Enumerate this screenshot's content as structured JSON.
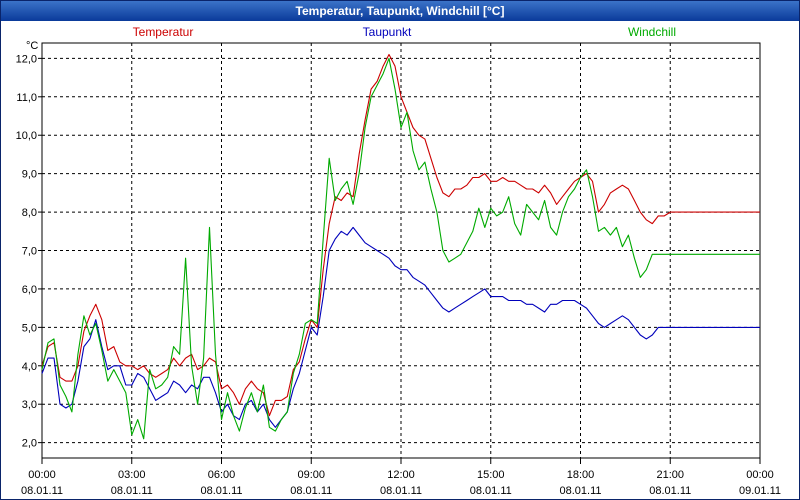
{
  "window": {
    "title": "Temperatur, Taupunkt, Windchill [°C]"
  },
  "chart_data": {
    "type": "line",
    "title": "Temperatur, Taupunkt, Windchill [°C]",
    "ylabel": "°C",
    "ylim": [
      1.6,
      12.4
    ],
    "yticks": [
      "2,0",
      "3,0",
      "4,0",
      "5,0",
      "6,0",
      "7,0",
      "8,0",
      "9,0",
      "10,0",
      "11,0",
      "12,0"
    ],
    "xlim": [
      0,
      24
    ],
    "xticks": [
      {
        "time": "00:00",
        "date": "08.01.11"
      },
      {
        "time": "03:00",
        "date": "08.01.11"
      },
      {
        "time": "06:00",
        "date": "08.01.11"
      },
      {
        "time": "09:00",
        "date": "08.01.11"
      },
      {
        "time": "12:00",
        "date": "08.01.11"
      },
      {
        "time": "15:00",
        "date": "08.01.11"
      },
      {
        "time": "18:00",
        "date": "08.01.11"
      },
      {
        "time": "21:00",
        "date": "08.01.11"
      },
      {
        "time": "00:00",
        "date": "09.01.11"
      }
    ],
    "grid": true,
    "legend_position": "top",
    "x": [
      0,
      0.2,
      0.4,
      0.6,
      0.8,
      1,
      1.2,
      1.4,
      1.6,
      1.8,
      2,
      2.2,
      2.4,
      2.6,
      2.8,
      3,
      3.2,
      3.4,
      3.6,
      3.8,
      4,
      4.2,
      4.4,
      4.6,
      4.8,
      5,
      5.2,
      5.4,
      5.6,
      5.8,
      6,
      6.2,
      6.4,
      6.6,
      6.8,
      7,
      7.2,
      7.4,
      7.6,
      7.8,
      8,
      8.2,
      8.4,
      8.6,
      8.8,
      9,
      9.2,
      9.4,
      9.6,
      9.8,
      10,
      10.2,
      10.4,
      10.6,
      10.8,
      11,
      11.2,
      11.4,
      11.6,
      11.8,
      12,
      12.2,
      12.4,
      12.6,
      12.8,
      13,
      13.2,
      13.4,
      13.6,
      13.8,
      14,
      14.2,
      14.4,
      14.6,
      14.8,
      15,
      15.2,
      15.4,
      15.6,
      15.8,
      16,
      16.2,
      16.4,
      16.6,
      16.8,
      17,
      17.2,
      17.4,
      17.6,
      17.8,
      18,
      18.2,
      18.4,
      18.6,
      18.8,
      19,
      19.2,
      19.4,
      19.6,
      19.8,
      20,
      20.2,
      20.4,
      20.6,
      20.8,
      21,
      21.2,
      21.4,
      21.6,
      21.8,
      22,
      22.2,
      22.4,
      22.6,
      22.8,
      23,
      23.2,
      23.4,
      23.6,
      23.8,
      24
    ],
    "series": [
      {
        "name": "Temperatur",
        "color": "#cc0000",
        "values": [
          4.0,
          4.5,
          4.6,
          3.7,
          3.6,
          3.6,
          4.0,
          4.9,
          5.3,
          5.6,
          5.2,
          4.4,
          4.5,
          4.1,
          4.0,
          4.0,
          3.9,
          4.0,
          3.8,
          3.7,
          3.8,
          3.9,
          4.2,
          4.0,
          4.2,
          4.3,
          3.9,
          4.0,
          4.2,
          4.1,
          3.4,
          3.5,
          3.3,
          3.0,
          3.4,
          3.6,
          3.4,
          3.3,
          2.7,
          3.1,
          3.1,
          3.2,
          3.9,
          4.1,
          4.7,
          5.2,
          5.0,
          6.5,
          7.7,
          8.4,
          8.3,
          8.5,
          8.4,
          9.5,
          10.4,
          11.2,
          11.4,
          11.8,
          12.1,
          11.8,
          11.0,
          10.6,
          10.2,
          10.0,
          9.9,
          9.4,
          8.9,
          8.5,
          8.4,
          8.6,
          8.6,
          8.7,
          8.9,
          8.9,
          9.0,
          8.8,
          8.8,
          8.9,
          8.8,
          8.8,
          8.7,
          8.6,
          8.6,
          8.5,
          8.7,
          8.5,
          8.2,
          8.4,
          8.6,
          8.8,
          8.9,
          9.0,
          8.8,
          8.0,
          8.2,
          8.5,
          8.6,
          8.7,
          8.6,
          8.3,
          8.0,
          7.8,
          7.7,
          7.9,
          7.9,
          8.0,
          8.0,
          8.0,
          8.0,
          8.0,
          8.0,
          8.0,
          8.0,
          8.0,
          8.0,
          8.0,
          8.0,
          8.0,
          8.0,
          8.0,
          8.0,
          8.0
        ]
      },
      {
        "name": "Taupunkt",
        "color": "#0000bb",
        "values": [
          3.8,
          4.2,
          4.2,
          3.0,
          2.9,
          3.0,
          3.6,
          4.5,
          4.7,
          5.2,
          4.5,
          3.9,
          4.0,
          4.0,
          3.5,
          3.5,
          3.8,
          3.7,
          3.4,
          3.1,
          3.2,
          3.3,
          3.6,
          3.5,
          3.3,
          3.5,
          3.4,
          3.7,
          3.7,
          3.3,
          2.8,
          3.0,
          2.7,
          2.6,
          3.0,
          3.1,
          2.8,
          3.0,
          2.6,
          2.4,
          2.6,
          2.8,
          3.4,
          3.8,
          4.4,
          5.0,
          4.8,
          5.8,
          7.0,
          7.3,
          7.5,
          7.4,
          7.6,
          7.4,
          7.2,
          7.1,
          7.0,
          6.9,
          6.8,
          6.6,
          6.5,
          6.5,
          6.3,
          6.2,
          6.1,
          5.9,
          5.7,
          5.5,
          5.4,
          5.5,
          5.6,
          5.7,
          5.8,
          5.9,
          6.0,
          5.8,
          5.8,
          5.8,
          5.7,
          5.7,
          5.7,
          5.6,
          5.6,
          5.5,
          5.4,
          5.6,
          5.6,
          5.7,
          5.7,
          5.7,
          5.6,
          5.5,
          5.3,
          5.1,
          5.0,
          5.1,
          5.2,
          5.3,
          5.2,
          5.0,
          4.8,
          4.7,
          4.8,
          5.0,
          5.0,
          5.0,
          5.0,
          5.0,
          5.0,
          5.0,
          5.0,
          5.0,
          5.0,
          5.0,
          5.0,
          5.0,
          5.0,
          5.0,
          5.0,
          5.0,
          5.0,
          5.0
        ]
      },
      {
        "name": "Windchill",
        "color": "#00aa00",
        "values": [
          3.9,
          4.6,
          4.7,
          3.5,
          3.2,
          2.8,
          4.3,
          5.3,
          4.8,
          5.1,
          4.4,
          3.6,
          3.9,
          3.6,
          3.3,
          2.2,
          2.6,
          2.1,
          3.9,
          3.4,
          3.5,
          3.7,
          4.5,
          4.3,
          6.8,
          4.0,
          3.0,
          4.2,
          7.6,
          4.3,
          2.6,
          3.3,
          2.7,
          2.3,
          2.9,
          3.3,
          2.8,
          3.5,
          2.4,
          2.3,
          2.6,
          2.8,
          3.8,
          4.3,
          5.1,
          5.2,
          5.1,
          7.3,
          9.4,
          8.3,
          8.6,
          8.8,
          8.2,
          9.0,
          10.2,
          11.0,
          11.3,
          11.6,
          12.0,
          11.2,
          10.2,
          10.6,
          9.6,
          9.1,
          9.3,
          8.6,
          8.0,
          7.0,
          6.7,
          6.8,
          6.9,
          7.2,
          7.5,
          8.1,
          7.6,
          8.1,
          7.9,
          8.0,
          8.4,
          7.7,
          7.4,
          8.2,
          8.0,
          7.8,
          8.3,
          7.6,
          7.4,
          8.0,
          8.4,
          8.6,
          8.9,
          9.1,
          8.4,
          7.5,
          7.6,
          7.4,
          7.6,
          7.1,
          7.4,
          6.8,
          6.3,
          6.5,
          6.9,
          6.9,
          6.9,
          6.9,
          6.9,
          6.9,
          6.9,
          6.9,
          6.9,
          6.9,
          6.9,
          6.9,
          6.9,
          6.9,
          6.9,
          6.9,
          6.9,
          6.9,
          6.9,
          6.9
        ]
      }
    ]
  }
}
